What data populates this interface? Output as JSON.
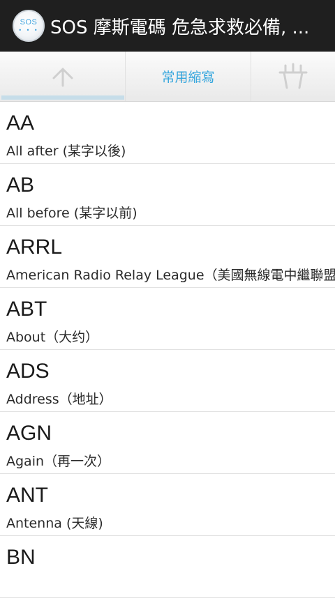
{
  "app": {
    "icon_text": "SOS",
    "title": "SOS 摩斯電碼 危急求救必備, ..."
  },
  "tabs": [
    {
      "icon": "arrow-up-icon",
      "selected": true
    },
    {
      "label": "常用縮寫",
      "selected": false
    },
    {
      "icon": "antenna-icon",
      "selected": false
    }
  ],
  "colors": {
    "titlebar": "#1f1f1f",
    "tab_accent": "#35a6dd",
    "indicator": "#c6dde9"
  },
  "entries": [
    {
      "abbr": "AA",
      "meaning": "All after (某字以後)"
    },
    {
      "abbr": "AB",
      "meaning": "All before (某字以前)"
    },
    {
      "abbr": "ARRL",
      "meaning": "American Radio Relay League（美國無線電中繼聯盟）"
    },
    {
      "abbr": "ABT",
      "meaning": "About（大约）"
    },
    {
      "abbr": "ADS",
      "meaning": "Address（地址）"
    },
    {
      "abbr": "AGN",
      "meaning": "Again（再一次）"
    },
    {
      "abbr": "ANT",
      "meaning": "Antenna (天線)"
    },
    {
      "abbr": "BN",
      "meaning": ""
    }
  ]
}
